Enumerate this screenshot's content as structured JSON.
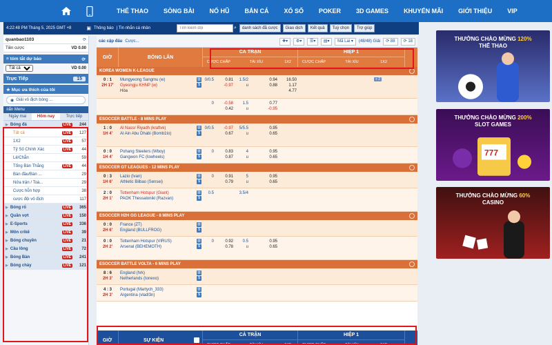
{
  "nav": {
    "items": [
      "THỂ THAO",
      "SÒNG BÀI",
      "NỔ HŨ",
      "BẮN CÁ",
      "XỔ SỐ",
      "POKER",
      "3D GAMES",
      "KHUYẾN MÃI",
      "GIỚI THIỆU",
      "VIP"
    ],
    "home_icon": "home-icon",
    "phone_icon": "mobile-icon"
  },
  "toolbar": {
    "datetime": "4:22:48 PM Tháng 5, 2025 GMT +8",
    "notice": "Thông báo",
    "personal_msg": "| Tin nhắn cá nhân",
    "search_placeholder": "Tìm kiếm đội",
    "buttons": [
      "danh sách đã cược",
      "Giao dịch",
      "Kết quả",
      "Tuỳ chọn",
      "Trợ giúp"
    ]
  },
  "account": {
    "username": "quanbao1103",
    "currency": "VD 0.00",
    "credit_label": "Tiền cược",
    "credit_value": "VD 0.00",
    "summary_title": "tóm tắt dự báo",
    "filter_value": "Tất cả",
    "summary_value": "VD 0.00",
    "live_label": "Trực Tiếp",
    "live_count": "15",
    "fav_title": "Mục ưa thích của tôi",
    "champions_btn": "Giải vô địch bóng ...",
    "menu_title": "ẩn Menu"
  },
  "sport_tabs": [
    "Ngày mai",
    "Hôm nay",
    "Trực tiếp"
  ],
  "sports": [
    {
      "label": "Bóng đá",
      "live": "LIVE",
      "count": "244",
      "type": "bold"
    },
    {
      "label": "Tất cả",
      "live": "LIVE",
      "count": "127",
      "type": "sub orange"
    },
    {
      "label": "1X2",
      "live": "LIVE",
      "count": "57",
      "type": "sub"
    },
    {
      "label": "Tỷ Số Chính Xác",
      "live": "LIVE",
      "count": "44",
      "type": "sub"
    },
    {
      "label": "Lẻ/Chẵn",
      "live": "",
      "count": "59",
      "type": "sub"
    },
    {
      "label": "Tổng Bàn Thắng",
      "live": "LIVE",
      "count": "44",
      "type": "sub"
    },
    {
      "label": "Bàn đầu/Bàn ...",
      "live": "",
      "count": "29",
      "type": "sub"
    },
    {
      "label": "Nửa trận / Toà...",
      "live": "",
      "count": "29",
      "type": "sub"
    },
    {
      "label": "Cược hỗn hợp",
      "live": "",
      "count": "38",
      "type": "sub"
    },
    {
      "label": "cược đội vô địch",
      "live": "",
      "count": "117",
      "type": "sub"
    },
    {
      "label": "Bóng rổ",
      "live": "LIVE",
      "count": "365",
      "type": "bold"
    },
    {
      "label": "Quần vợt",
      "live": "LIVE",
      "count": "150",
      "type": "bold"
    },
    {
      "label": "E-Sports",
      "live": "LIVE",
      "count": "336",
      "type": "bold"
    },
    {
      "label": "Môn crikê",
      "live": "LIVE",
      "count": "39",
      "type": "bold"
    },
    {
      "label": "Bóng chuyền",
      "live": "LIVE",
      "count": "21",
      "type": "bold"
    },
    {
      "label": "Cầu lông",
      "live": "LIVE",
      "count": "72",
      "type": "bold"
    },
    {
      "label": "Bóng Bàn",
      "live": "LIVE",
      "count": "241",
      "type": "bold"
    },
    {
      "label": "Bóng chày",
      "live": "LIVE",
      "count": "121",
      "type": "bold"
    }
  ],
  "filterbar": {
    "title": "các cập đấu",
    "more": "Cược...",
    "market": "Mã Lai",
    "league_count": "(48/48) Giải",
    "n1": "88",
    "n2": "18"
  },
  "table_header": {
    "gio": "GIỜ",
    "bong_lan": "BÓNG LĂN",
    "su_kien": "SỰ KIỆN",
    "ca_tran": "CẢ TRẬN",
    "hiep1": "HIỆP 1",
    "sub": [
      "CƯỢC CHẤP",
      "TÀI XỈU",
      "1X2",
      "CƯỢC CHẤP",
      "TÀI XỈU",
      "1X2"
    ]
  },
  "leagues": [
    {
      "name": "KOREA WOMEN K-LEAGUE",
      "matches": [
        {
          "score": "0 : 1",
          "min": "2H 17'",
          "t1": "Mungyeong Sangmu (w)",
          "t1red": false,
          "t2": "Gyeongju KHNP (w)",
          "t2red": true,
          "draw": "Hòa",
          "hc": [
            "",
            "0/0.5",
            ""
          ],
          "hco": [
            "0.81",
            "-0.97",
            ""
          ],
          "ou": [
            "1.5/2",
            "u",
            ""
          ],
          "ouo": [
            "0.94",
            "0.88",
            ""
          ],
          "x12": [
            "16.50",
            "1.17",
            "4.77"
          ],
          "plus": "+ 2",
          "tall": true
        },
        {
          "score": "",
          "min": "",
          "t1": "",
          "t1red": false,
          "t2": "",
          "t2red": false,
          "draw": "",
          "hc": [
            "",
            "0",
            ""
          ],
          "hco": [
            "-0.58",
            "0.42",
            ""
          ],
          "ou": [
            "1.5",
            "u",
            ""
          ],
          "ouo": [
            "0.77",
            "-0.95",
            ""
          ],
          "x12": [
            "",
            "",
            ""
          ],
          "plus": "",
          "tall": false
        }
      ]
    },
    {
      "name": "ESOCCER BATTLE - 8 MINS PLAY",
      "matches": [
        {
          "score": "1 : 0",
          "min": "1H 4'",
          "t1": "Al Nassr Riyadh (kraftvk)",
          "t1red": true,
          "t2": "Al Ain Abu Dhabi (Bomb1to)",
          "t2red": false,
          "draw": "",
          "hc": [
            "0/0.5",
            "",
            ""
          ],
          "hco": [
            "-0.97",
            "0.67",
            ""
          ],
          "ou": [
            "5/5.5",
            "u",
            ""
          ],
          "ouo": [
            "0.95",
            "0.65",
            ""
          ],
          "x12": [
            "",
            "",
            ""
          ],
          "plus": "",
          "tall": true
        },
        {
          "score": "0 : 0",
          "min": "1H 4'",
          "t1": "Pohang Steelers (Wboy)",
          "t1red": false,
          "t2": "Gangwon FC (lowheels)",
          "t2red": false,
          "draw": "",
          "hc": [
            "0",
            "",
            ""
          ],
          "hco": [
            "0.83",
            "0.87",
            ""
          ],
          "ou": [
            "4",
            "u",
            ""
          ],
          "ouo": [
            "0.95",
            "0.65",
            ""
          ],
          "x12": [
            "",
            "",
            ""
          ],
          "plus": "",
          "tall": false
        }
      ]
    },
    {
      "name": "ESOCCER GT LEAGUES - 12 MINS PLAY",
      "matches": [
        {
          "score": "0 : 3",
          "min": "1H 6'",
          "t1": "Lazio (Ivan)",
          "t1red": false,
          "t2": "Athletic Bilbao (Sensei)",
          "t2red": false,
          "draw": "",
          "hc": [
            "",
            "0",
            ""
          ],
          "hco": [
            "0.91",
            "0.79",
            ""
          ],
          "ou": [
            "5",
            "u",
            ""
          ],
          "ouo": [
            "0.95",
            "0.65",
            ""
          ],
          "x12": [
            "",
            "",
            ""
          ],
          "plus": "",
          "tall": false
        },
        {
          "score": "2 : 0",
          "min": "2H 1'",
          "t1": "Tottenham Hotspur (Giant)",
          "t1red": true,
          "t2": "PAOK Thessaloniki (Razvan)",
          "t2red": false,
          "draw": "",
          "hc": [
            "0.5",
            "",
            ""
          ],
          "hco": [
            "",
            "",
            ""
          ],
          "ou": [
            "3.5/4",
            "",
            ""
          ],
          "ouo": [
            "",
            "",
            ""
          ],
          "x12": [
            "",
            "",
            ""
          ],
          "plus": "",
          "tall": true
        }
      ]
    },
    {
      "name": "ESOCCER H2H GG LEAGUE - 8 MINS PLAY",
      "matches": [
        {
          "score": "0 : 0",
          "min": "2H 6'",
          "t1": "France (ZT)",
          "t1red": false,
          "t2": "England (BULLFROG)",
          "t2red": false,
          "draw": "",
          "hc": [
            "",
            "",
            ""
          ],
          "hco": [
            "",
            "",
            ""
          ],
          "ou": [
            "",
            "",
            ""
          ],
          "ouo": [
            "",
            "",
            ""
          ],
          "x12": [
            "",
            "",
            ""
          ],
          "plus": "",
          "tall": false
        },
        {
          "score": "0 : 0",
          "min": "2H 2'",
          "t1": "Tottenham Hotspur (VIRUS)",
          "t1red": false,
          "t2": "Arsenal (BEHEMOTH)",
          "t2red": false,
          "draw": "",
          "hc": [
            "0",
            "",
            ""
          ],
          "hco": [
            "0.92",
            "0.78",
            ""
          ],
          "ou": [
            "0.5",
            "u",
            ""
          ],
          "ouo": [
            "0.95",
            "0.65",
            ""
          ],
          "x12": [
            "",
            "",
            ""
          ],
          "plus": "",
          "tall": true
        }
      ]
    },
    {
      "name": "ESOCCER BATTLE VOLTA - 6 MINS PLAY",
      "matches": [
        {
          "score": "8 : 6",
          "min": "2H 3'",
          "t1": "England (hrk)",
          "t1red": false,
          "t2": "Netherlands (tonexo)",
          "t2red": false,
          "draw": "",
          "hc": [
            "",
            "",
            ""
          ],
          "hco": [
            "",
            "",
            ""
          ],
          "ou": [
            "",
            "",
            ""
          ],
          "ouo": [
            "",
            "",
            ""
          ],
          "x12": [
            "",
            "",
            ""
          ],
          "plus": "",
          "tall": false
        },
        {
          "score": "4 : 3",
          "min": "2H 3'",
          "t1": "Portugal (Martych_333)",
          "t1red": false,
          "t2": "Argentina (vladl3n)",
          "t2red": false,
          "draw": "",
          "hc": [
            "",
            "",
            ""
          ],
          "hco": [
            "",
            "",
            ""
          ],
          "ou": [
            "",
            "",
            ""
          ],
          "ouo": [
            "",
            "",
            ""
          ],
          "x12": [
            "",
            "",
            ""
          ],
          "plus": "",
          "tall": false
        }
      ]
    }
  ],
  "promos": [
    {
      "line1": "THƯỞNG CHÀO MỪNG ",
      "hl": "120%",
      "line2": "THỂ THAO"
    },
    {
      "line1": "THƯỞNG CHÀO MỪNG ",
      "hl": "200%",
      "line2": "SLOT GAMES"
    },
    {
      "line1": "THƯỞNG CHÀO MỪNG ",
      "hl": "60%",
      "line2": "CASINO"
    }
  ],
  "colors": {
    "nav": "#1c6fc4",
    "header_orange": "#e07a3f",
    "league_bar": "#d9703a",
    "row_bg": "#fcebd9",
    "live_red": "#c8281e",
    "highlight": "#e3141a"
  }
}
